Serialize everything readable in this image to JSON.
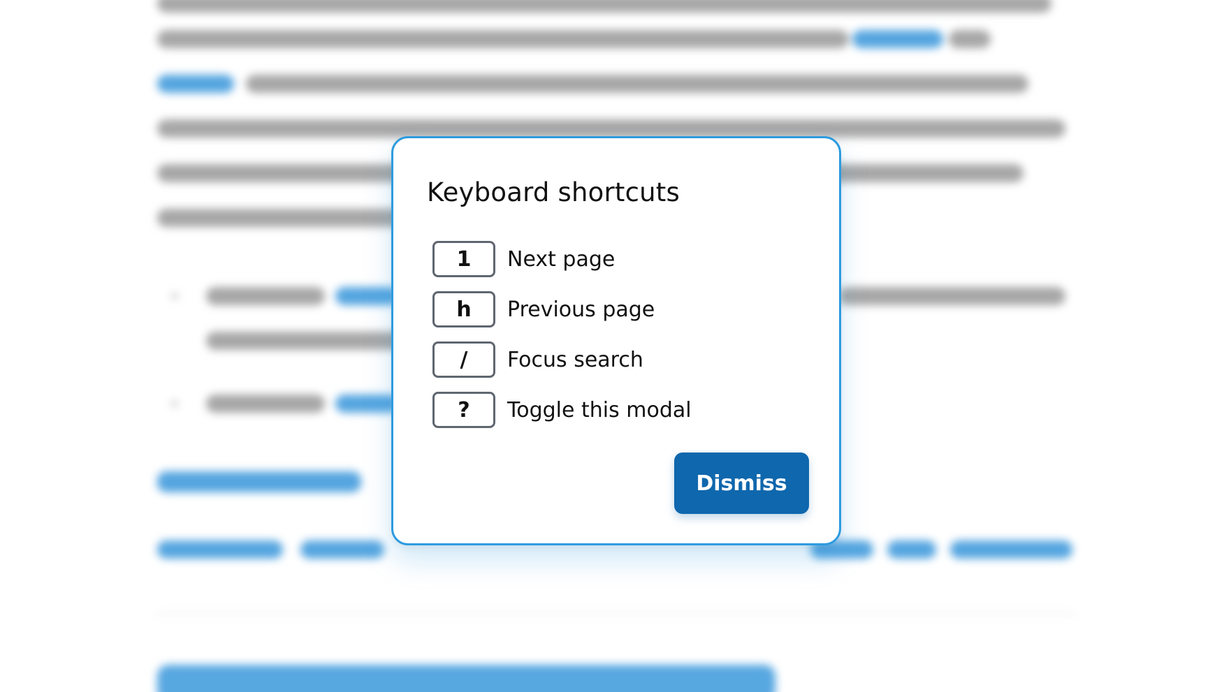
{
  "modal": {
    "title": "Keyboard shortcuts",
    "shortcuts": [
      {
        "key": "1",
        "description": "Next page"
      },
      {
        "key": "h",
        "description": "Previous page"
      },
      {
        "key": "/",
        "description": "Focus search"
      },
      {
        "key": "?",
        "description": "Toggle this modal"
      }
    ],
    "dismiss_label": "Dismiss"
  },
  "colors": {
    "accent": "#2d9be0",
    "button": "#0f67ad",
    "key_border": "#5f6670"
  }
}
